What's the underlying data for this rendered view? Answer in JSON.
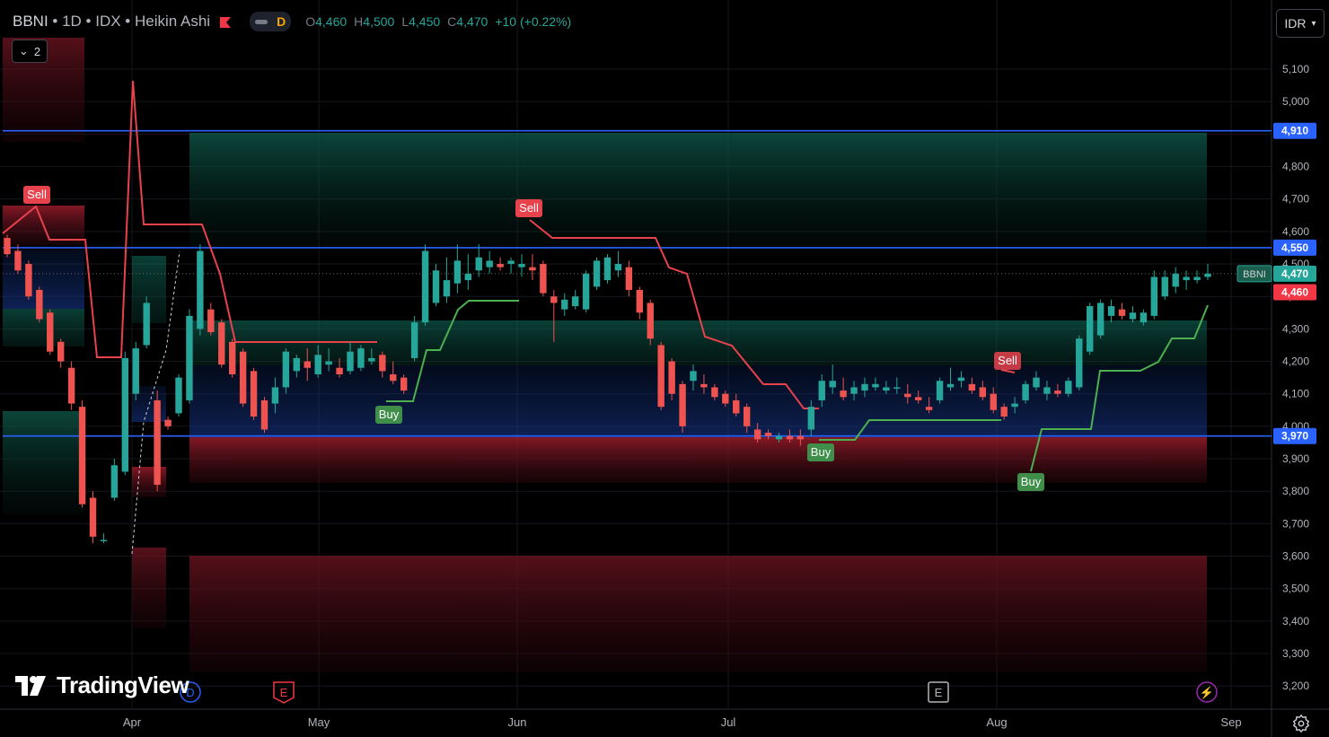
{
  "header": {
    "symbol": "BBNI",
    "interval": "1D",
    "exchange": "IDX",
    "chart_style": "Heikin Ashi",
    "badge": "D",
    "ohlc": {
      "o_label": "O",
      "o": "4,460",
      "h_label": "H",
      "h": "4,500",
      "l_label": "L",
      "l": "4,450",
      "c_label": "C",
      "c": "4,470",
      "change": "+10 (+0.22%)"
    },
    "indicator_count": "2",
    "currency": "IDR"
  },
  "brand": "TradingView",
  "colors": {
    "bull": "#26a69a",
    "bear": "#ef5350",
    "supertrend_up": "#4caf50",
    "supertrend_down": "#e8424d",
    "hline": "#2962ff",
    "bg": "#000000"
  },
  "chart_data": {
    "type": "candlestick",
    "chart_style": "Heikin Ashi",
    "y_axis": {
      "ticks": [
        5100,
        5000,
        4900,
        4800,
        4700,
        4600,
        4500,
        4400,
        4300,
        4200,
        4100,
        4000,
        3900,
        3800,
        3700,
        3600,
        3500,
        3400,
        3300,
        3200
      ],
      "ylim": [
        3170,
        5170
      ],
      "position": "right"
    },
    "x_axis": {
      "ticks": [
        "Apr",
        "May",
        "Jun",
        "Jul",
        "Aug",
        "Sep"
      ]
    },
    "price_lines": [
      {
        "label": "4,910",
        "value": 4910,
        "color": "#2962ff"
      },
      {
        "label": "4,550",
        "value": 4550,
        "color": "#2962ff"
      },
      {
        "label": "3,970",
        "value": 3970,
        "color": "#2962ff"
      }
    ],
    "axis_labels": [
      {
        "text": "4,470",
        "value": 4470,
        "color": "#26a69a",
        "tag": "BBNI"
      },
      {
        "text": "4,460",
        "value": 4460,
        "color": "#f23645"
      }
    ],
    "signals": [
      {
        "text": "Sell",
        "type": "sell"
      },
      {
        "text": "Buy",
        "type": "buy"
      },
      {
        "text": "Sell",
        "type": "sell"
      },
      {
        "text": "Buy",
        "type": "buy"
      },
      {
        "text": "Sell",
        "type": "sell"
      },
      {
        "text": "Buy",
        "type": "buy"
      }
    ],
    "event_markers": [
      "D",
      "E",
      "E",
      "⚡"
    ],
    "candles": [
      [
        4580,
        4590,
        4520,
        4530
      ],
      [
        4540,
        4560,
        4470,
        4480
      ],
      [
        4500,
        4510,
        4390,
        4400
      ],
      [
        4420,
        4430,
        4320,
        4330
      ],
      [
        4350,
        4360,
        4220,
        4230
      ],
      [
        4260,
        4270,
        4180,
        4200
      ],
      [
        4180,
        4200,
        4050,
        4070
      ],
      [
        4060,
        4080,
        3750,
        3760
      ],
      [
        3780,
        3800,
        3640,
        3660
      ],
      [
        3650,
        3670,
        3640,
        3650
      ],
      [
        3780,
        3900,
        3770,
        3880
      ],
      [
        3860,
        4230,
        3850,
        4210
      ],
      [
        4100,
        4260,
        4080,
        4240
      ],
      [
        4250,
        4400,
        4240,
        4380
      ],
      [
        4080,
        4110,
        3800,
        3820
      ],
      [
        4020,
        4030,
        3990,
        4000
      ],
      [
        4040,
        4160,
        4030,
        4150
      ],
      [
        4080,
        4360,
        4070,
        4340
      ],
      [
        4300,
        4560,
        4280,
        4540
      ],
      [
        4360,
        4380,
        4280,
        4290
      ],
      [
        4320,
        4330,
        4180,
        4190
      ],
      [
        4260,
        4270,
        4150,
        4160
      ],
      [
        4230,
        4240,
        4060,
        4070
      ],
      [
        4170,
        4180,
        4020,
        4030
      ],
      [
        4080,
        4090,
        3980,
        3990
      ],
      [
        4070,
        4150,
        4040,
        4120
      ],
      [
        4120,
        4240,
        4100,
        4230
      ],
      [
        4170,
        4220,
        4150,
        4210
      ],
      [
        4200,
        4240,
        4140,
        4180
      ],
      [
        4160,
        4250,
        4150,
        4220
      ],
      [
        4190,
        4240,
        4170,
        4200
      ],
      [
        4180,
        4210,
        4150,
        4160
      ],
      [
        4170,
        4260,
        4160,
        4230
      ],
      [
        4180,
        4250,
        4170,
        4240
      ],
      [
        4200,
        4240,
        4190,
        4210
      ],
      [
        4220,
        4230,
        4150,
        4170
      ],
      [
        4160,
        4200,
        4130,
        4140
      ],
      [
        4150,
        4160,
        4100,
        4110
      ],
      [
        4210,
        4340,
        4200,
        4320
      ],
      [
        4320,
        4560,
        4310,
        4540
      ],
      [
        4380,
        4500,
        4370,
        4480
      ],
      [
        4400,
        4520,
        4380,
        4450
      ],
      [
        4440,
        4560,
        4410,
        4510
      ],
      [
        4450,
        4530,
        4420,
        4470
      ],
      [
        4480,
        4560,
        4460,
        4520
      ],
      [
        4490,
        4540,
        4470,
        4510
      ],
      [
        4500,
        4520,
        4480,
        4490
      ],
      [
        4500,
        4520,
        4470,
        4510
      ],
      [
        4490,
        4530,
        4460,
        4500
      ],
      [
        4490,
        4530,
        4450,
        4480
      ],
      [
        4500,
        4510,
        4400,
        4410
      ],
      [
        4400,
        4420,
        4260,
        4380
      ],
      [
        4360,
        4410,
        4340,
        4390
      ],
      [
        4370,
        4420,
        4360,
        4400
      ],
      [
        4360,
        4480,
        4350,
        4470
      ],
      [
        4430,
        4520,
        4420,
        4510
      ],
      [
        4450,
        4530,
        4440,
        4520
      ],
      [
        4480,
        4540,
        4460,
        4500
      ],
      [
        4490,
        4510,
        4400,
        4420
      ],
      [
        4420,
        4430,
        4330,
        4350
      ],
      [
        4380,
        4390,
        4250,
        4270
      ],
      [
        4250,
        4260,
        4050,
        4060
      ],
      [
        4200,
        4210,
        4080,
        4100
      ],
      [
        4130,
        4140,
        3980,
        4000
      ],
      [
        4140,
        4190,
        4110,
        4170
      ],
      [
        4130,
        4160,
        4100,
        4120
      ],
      [
        4120,
        4130,
        4080,
        4090
      ],
      [
        4100,
        4110,
        4060,
        4070
      ],
      [
        4080,
        4100,
        4030,
        4040
      ],
      [
        4060,
        4070,
        3980,
        4000
      ],
      [
        3990,
        4010,
        3950,
        3960
      ],
      [
        3980,
        3990,
        3960,
        3970
      ],
      [
        3960,
        3980,
        3950,
        3970
      ],
      [
        3970,
        3990,
        3950,
        3960
      ],
      [
        3970,
        3990,
        3940,
        3960
      ],
      [
        3990,
        4080,
        3970,
        4060
      ],
      [
        4080,
        4160,
        4060,
        4140
      ],
      [
        4120,
        4190,
        4100,
        4140
      ],
      [
        4110,
        4150,
        4080,
        4090
      ],
      [
        4100,
        4140,
        4080,
        4120
      ],
      [
        4110,
        4150,
        4090,
        4130
      ],
      [
        4120,
        4150,
        4110,
        4130
      ],
      [
        4110,
        4140,
        4100,
        4120
      ],
      [
        4120,
        4150,
        4100,
        4120
      ],
      [
        4100,
        4130,
        4070,
        4090
      ],
      [
        4090,
        4110,
        4070,
        4080
      ],
      [
        4060,
        4090,
        4040,
        4050
      ],
      [
        4080,
        4150,
        4070,
        4140
      ],
      [
        4120,
        4180,
        4110,
        4130
      ],
      [
        4140,
        4170,
        4120,
        4150
      ],
      [
        4130,
        4150,
        4100,
        4110
      ],
      [
        4120,
        4140,
        4080,
        4090
      ],
      [
        4100,
        4120,
        4040,
        4050
      ],
      [
        4060,
        4070,
        4020,
        4030
      ],
      [
        4060,
        4090,
        4040,
        4070
      ],
      [
        4080,
        4140,
        4070,
        4130
      ],
      [
        4120,
        4170,
        4110,
        4150
      ],
      [
        4100,
        4140,
        4080,
        4120
      ],
      [
        4110,
        4130,
        4090,
        4100
      ],
      [
        4100,
        4150,
        4090,
        4140
      ],
      [
        4120,
        4280,
        4110,
        4270
      ],
      [
        4230,
        4380,
        4220,
        4370
      ],
      [
        4280,
        4390,
        4270,
        4380
      ],
      [
        4340,
        4390,
        4320,
        4370
      ],
      [
        4360,
        4380,
        4330,
        4340
      ],
      [
        4330,
        4370,
        4320,
        4350
      ],
      [
        4320,
        4360,
        4310,
        4350
      ],
      [
        4340,
        4480,
        4330,
        4460
      ],
      [
        4400,
        4480,
        4390,
        4460
      ],
      [
        4430,
        4490,
        4410,
        4470
      ],
      [
        4450,
        4480,
        4420,
        4460
      ],
      [
        4450,
        4480,
        4440,
        4460
      ],
      [
        4460,
        4500,
        4450,
        4470
      ]
    ]
  }
}
